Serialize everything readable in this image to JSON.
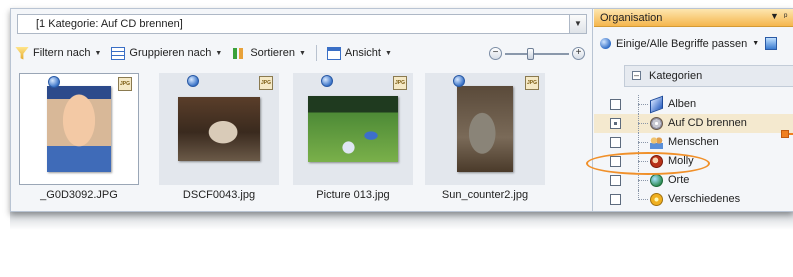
{
  "breadcrumb": {
    "text": "[1 Kategorie: Auf CD brennen]"
  },
  "toolbar": {
    "filter_label": "Filtern nach",
    "group_label": "Gruppieren nach",
    "sort_label": "Sortieren",
    "view_label": "Ansicht"
  },
  "zoom": {
    "level_fraction": 0.4
  },
  "thumbnails": [
    {
      "filename": "_G0D3092.JPG",
      "badge": "JPG",
      "selected": true
    },
    {
      "filename": "DSCF0043.jpg",
      "badge": "JPG",
      "selected": false
    },
    {
      "filename": "Picture 013.jpg",
      "badge": "JPG",
      "selected": false
    },
    {
      "filename": "Sun_counter2.jpg",
      "badge": "JPG",
      "selected": false
    }
  ],
  "organisation": {
    "title": "Organisation",
    "match_label": "Einige/Alle Begriffe passen",
    "categories_header": "Kategorien",
    "items": [
      {
        "label": "Alben",
        "icon": "album-icon",
        "checkbox": "unchecked"
      },
      {
        "label": "Auf CD brennen",
        "icon": "cd-icon",
        "checkbox": "mixed",
        "active": true
      },
      {
        "label": "Menschen",
        "icon": "people-icon",
        "checkbox": "unchecked"
      },
      {
        "label": "Molly",
        "icon": "person-tag-icon",
        "checkbox": "unchecked",
        "highlighted": true
      },
      {
        "label": "Orte",
        "icon": "globe-icon",
        "checkbox": "unchecked"
      },
      {
        "label": "Verschiedenes",
        "icon": "misc-icon",
        "checkbox": "unchecked"
      }
    ]
  },
  "colors": {
    "accent_orange": "#f08020",
    "panel_header": "#f5b64d"
  }
}
